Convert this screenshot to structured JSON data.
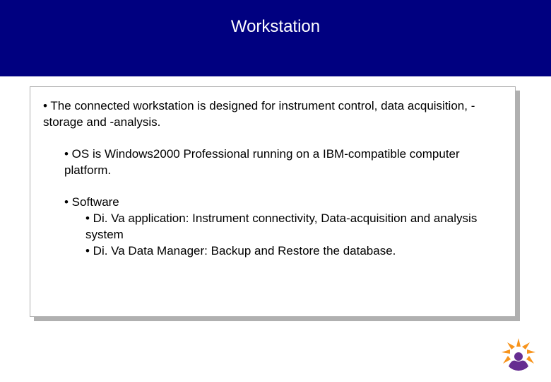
{
  "title": "Workstation",
  "bullets": {
    "b1": "• The connected workstation is designed for instrument control, data acquisition, -storage and -analysis.",
    "b2": "• OS is Windows2000 Professional running on a IBM-compatible computer platform.",
    "b3_head": "• Software",
    "b3_sub1": "• Di. Va application: Instrument connectivity, Data-acquisition and analysis system",
    "b3_sub2": "• Di. Va Data Manager: Backup and Restore the database."
  },
  "colors": {
    "title_band": "#000080",
    "logo_orange": "#F7941D",
    "logo_purple": "#662D91"
  }
}
